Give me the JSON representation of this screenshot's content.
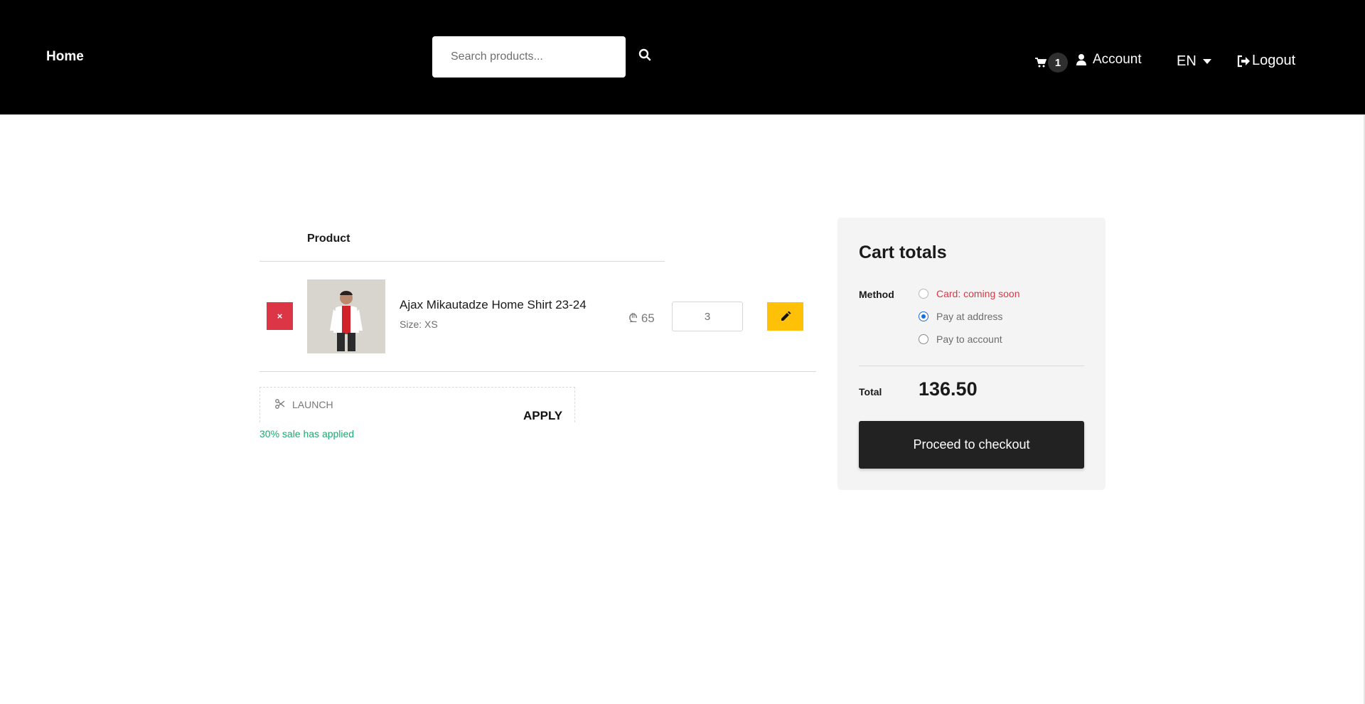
{
  "header": {
    "home_label": "Home",
    "search_placeholder": "Search products...",
    "cart_count": "1",
    "account_label": "Account",
    "language": "EN",
    "logout_label": "Logout"
  },
  "cart": {
    "column_product": "Product",
    "items": [
      {
        "remove_label": "×",
        "name": "Ajax Mikautadze Home Shirt 23-24",
        "size": "Size: XS",
        "price": "₾ 65",
        "quantity": "3"
      }
    ]
  },
  "coupon": {
    "code": "LAUNCH",
    "apply_label": "APPLY",
    "message": "30% sale has applied",
    "message_color": "#1fa870"
  },
  "totals": {
    "title": "Cart totals",
    "method_label": "Method",
    "methods": [
      {
        "label": "Card: coming soon",
        "checked": false,
        "color": "#dc3545"
      },
      {
        "label": "Pay at address",
        "checked": true
      },
      {
        "label": "Pay to account",
        "checked": false
      }
    ],
    "total_label": "Total",
    "total_value": "136.50",
    "checkout_label": "Proceed to checkout"
  },
  "colors": {
    "header_bg": "#000000",
    "remove_bg": "#dc3545",
    "edit_bg": "#ffc107",
    "checkout_bg": "#222222",
    "radio_accent": "#1a6ed8"
  }
}
